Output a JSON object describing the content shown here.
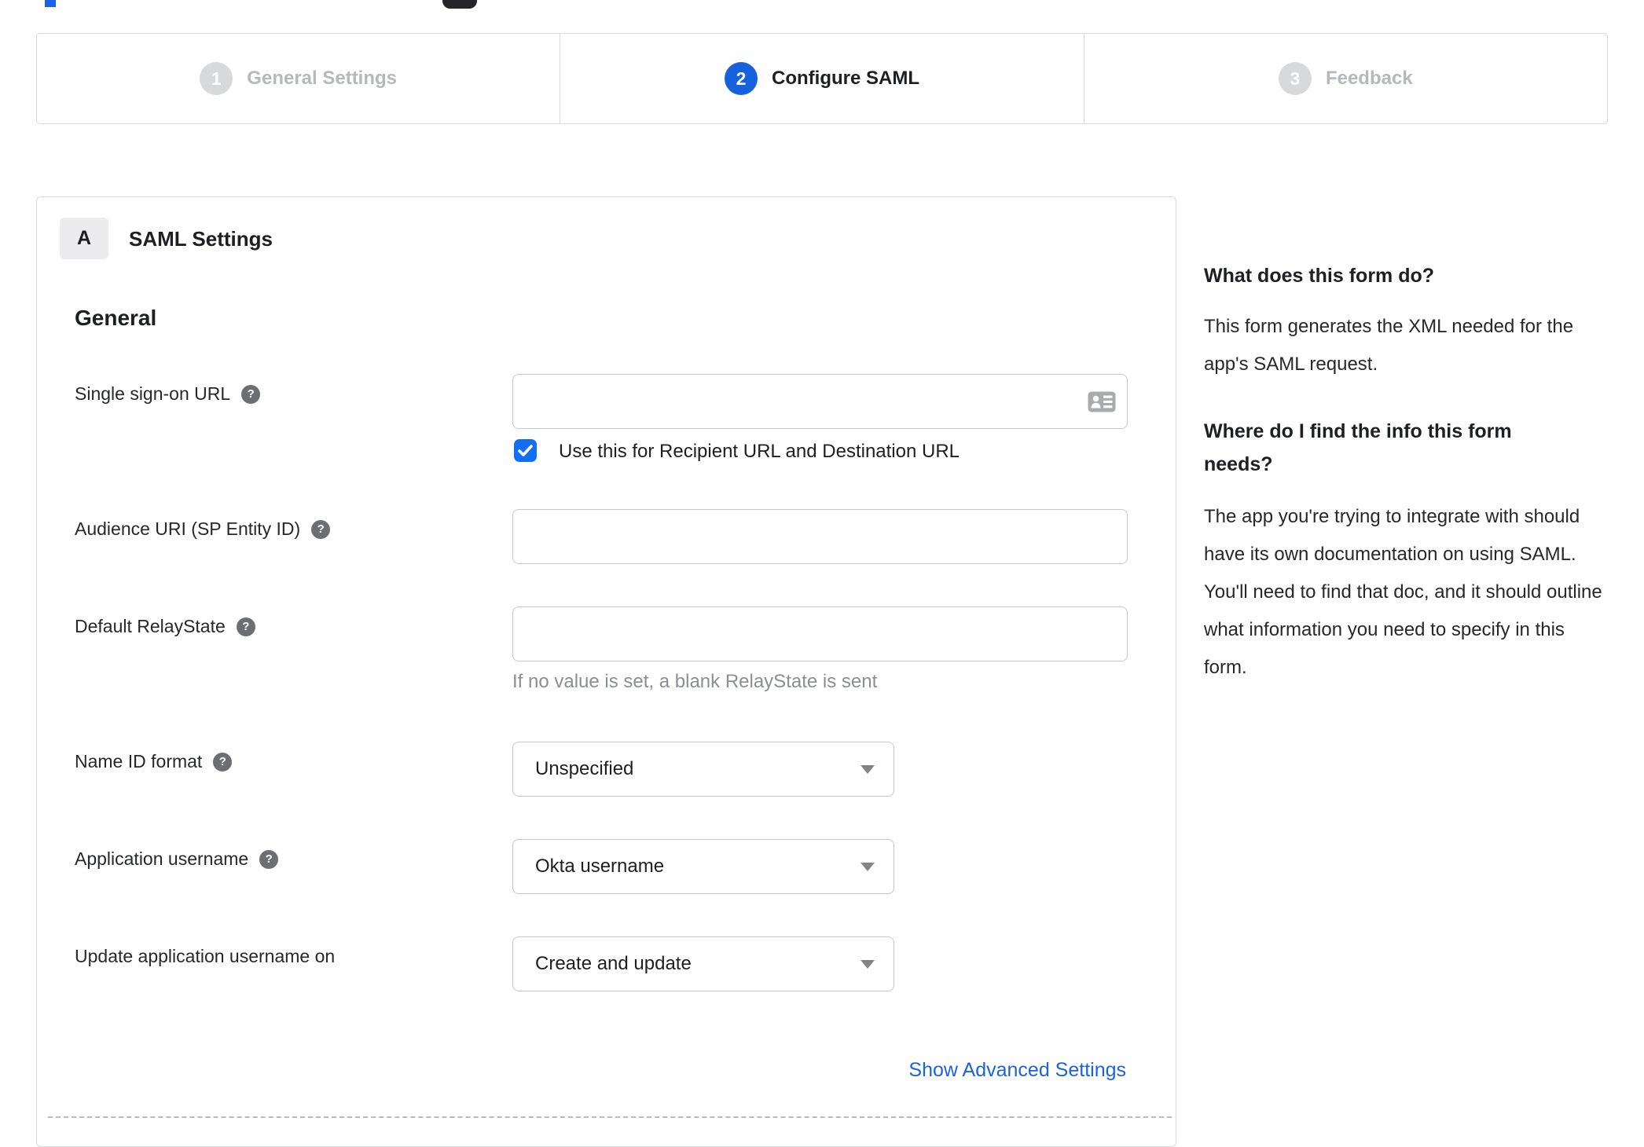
{
  "stepper": {
    "steps": [
      {
        "number": "1",
        "label": "General Settings",
        "state": "inactive"
      },
      {
        "number": "2",
        "label": "Configure SAML",
        "state": "active"
      },
      {
        "number": "3",
        "label": "Feedback",
        "state": "inactive"
      }
    ]
  },
  "panel": {
    "badge": "A",
    "title": "SAML Settings",
    "section_heading": "General",
    "fields": [
      {
        "label": "Single sign-on URL",
        "type": "text",
        "value": "",
        "checkbox": {
          "checked": true,
          "label": "Use this for Recipient URL and Destination URL"
        }
      },
      {
        "label": "Audience URI (SP Entity ID)",
        "type": "text",
        "value": ""
      },
      {
        "label": "Default RelayState",
        "type": "text",
        "value": "",
        "hint": "If no value is set, a blank RelayState is sent"
      },
      {
        "label": "Name ID format",
        "type": "select",
        "value": "Unspecified"
      },
      {
        "label": "Application username",
        "type": "select",
        "value": "Okta username"
      },
      {
        "label": "Update application username on",
        "type": "select",
        "value": "Create and update"
      }
    ],
    "advanced_link": "Show Advanced Settings"
  },
  "sidebar": {
    "sections": [
      {
        "heading": "What does this form do?",
        "body": "This form generates the XML needed for the app's SAML request."
      },
      {
        "heading": "Where do I find the info this form needs?",
        "body": "The app you're trying to integrate with should have its own documentation on using SAML. You'll need to find that doc, and it should outline what information you need to specify in this form."
      }
    ]
  },
  "colors": {
    "active_step_blue": "#1662dd",
    "checkbox_blue": "#146ef5",
    "link_blue": "#1b63dd",
    "inactive_gray": "#b5b8bc",
    "border_gray": "#c8c9cb"
  }
}
